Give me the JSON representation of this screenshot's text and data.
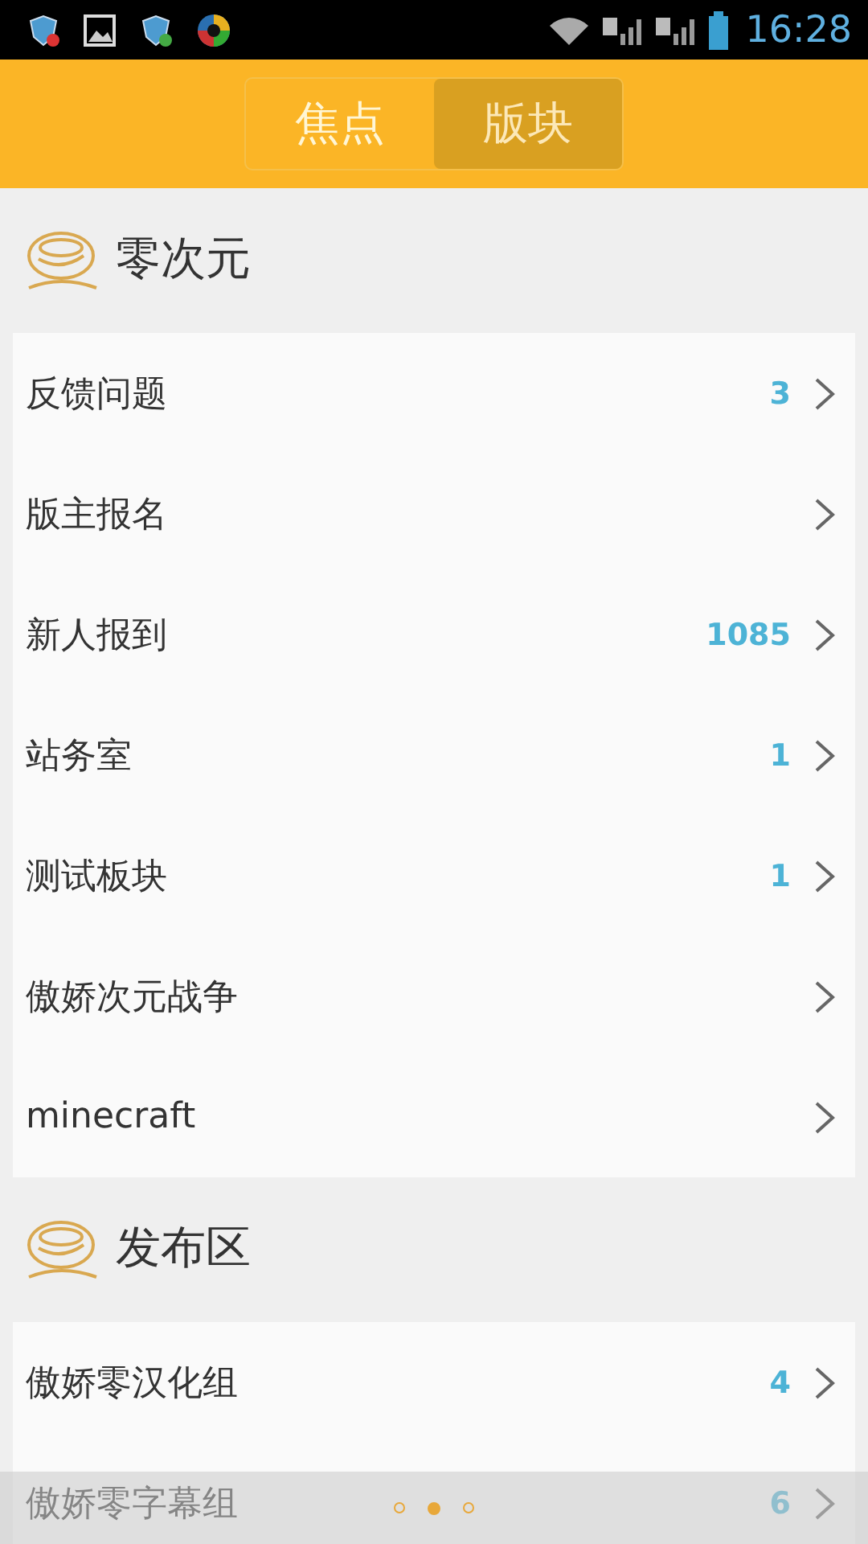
{
  "status_bar": {
    "time": "16:28"
  },
  "tabs": [
    {
      "label": "焦点",
      "selected": false
    },
    {
      "label": "版块",
      "selected": true
    }
  ],
  "sections": [
    {
      "title": "零次元",
      "items": [
        {
          "label": "反馈问题",
          "count": "3"
        },
        {
          "label": "版主报名"
        },
        {
          "label": "新人报到",
          "count": "1085"
        },
        {
          "label": "站务室",
          "count": "1"
        },
        {
          "label": "测试板块",
          "count": "1"
        },
        {
          "label": "傲娇次元战争"
        },
        {
          "label": "minecraft"
        }
      ]
    },
    {
      "title": "发布区",
      "items": [
        {
          "label": "傲娇零汉化组",
          "count": "4"
        },
        {
          "label": "傲娇零字幕组",
          "count": "6"
        }
      ]
    }
  ],
  "pager": [
    {
      "selected": false
    },
    {
      "selected": true
    },
    {
      "selected": false
    }
  ]
}
